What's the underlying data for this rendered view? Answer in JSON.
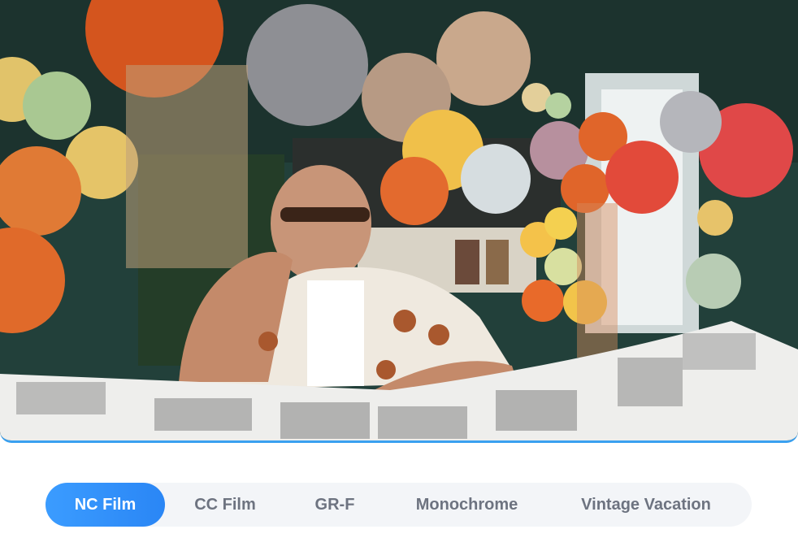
{
  "photo": {
    "alt": ""
  },
  "filter_tabs": {
    "items": [
      {
        "label": "NC Film",
        "active": true
      },
      {
        "label": "CC Film",
        "active": false
      },
      {
        "label": "GR-F",
        "active": false
      },
      {
        "label": "Monochrome",
        "active": false
      },
      {
        "label": "Vintage Vacation",
        "active": false
      }
    ]
  },
  "colors": {
    "accent": "#2a86f5",
    "tab_bar_bg": "#f3f5f8",
    "tab_text": "#6d7380"
  }
}
